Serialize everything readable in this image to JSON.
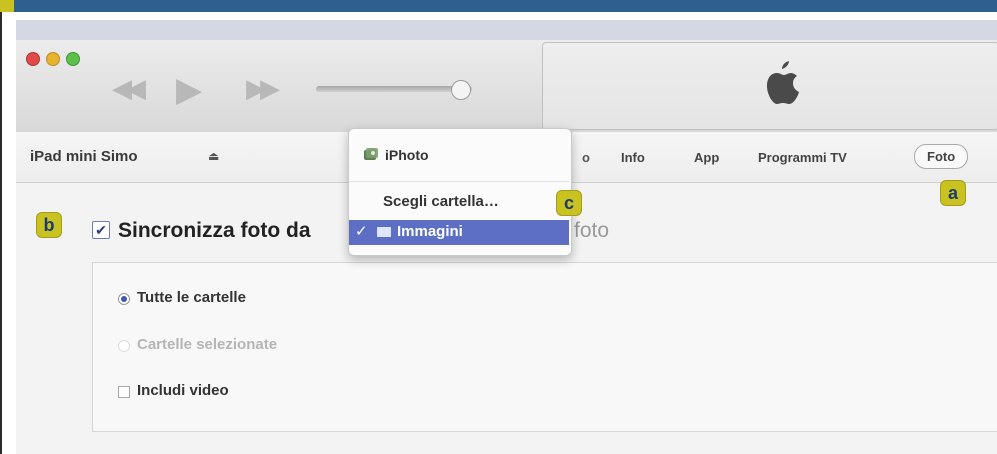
{
  "colors": {
    "top_bar": "#2f5f8f",
    "badge_bg": "#c9c221",
    "badge_text": "#1a3b74",
    "selection": "#5d6fc4"
  },
  "window": {
    "traffic_lights": [
      "close-icon",
      "minimize-icon",
      "zoom-icon"
    ]
  },
  "player": {
    "rewind_icon": "rewind-icon",
    "play_icon": "play-icon",
    "forward_icon": "fast-forward-icon",
    "volume_level": 0.92
  },
  "lcd": {
    "icon": "apple-logo-icon"
  },
  "nav": {
    "device_name": "iPad mini Simo",
    "eject_glyph": "⏏",
    "tabs": [
      {
        "label": "o"
      },
      {
        "label": "Info"
      },
      {
        "label": "App"
      },
      {
        "label": "Programmi TV"
      },
      {
        "label": "Foto"
      }
    ]
  },
  "sync": {
    "check_glyph": "✔",
    "label": "Sincronizza foto da",
    "label_tail": "foto"
  },
  "options": {
    "all_folders": "Tutte le cartelle",
    "selected_folders": "Cartelle selezionate",
    "include_video": "Includi video"
  },
  "dropdown": {
    "iphoto_label": "iPhoto",
    "choose_folder": "Scegli cartella…",
    "selected_glyph": "✓",
    "selected_label": "Immagini"
  },
  "badges": {
    "a": "a",
    "b": "b",
    "c": "c"
  }
}
